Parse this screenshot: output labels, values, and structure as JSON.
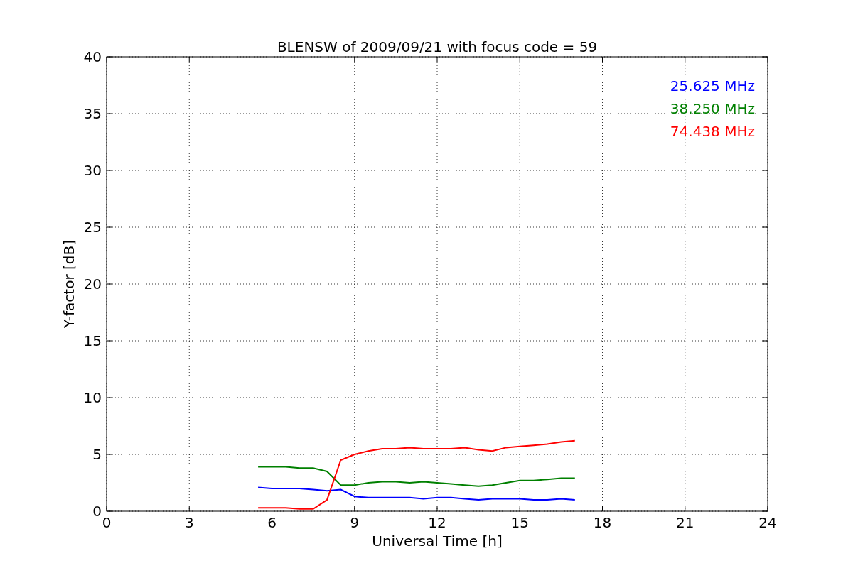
{
  "chart_data": {
    "type": "line",
    "title": "BLENSW of 2009/09/21 with focus code = 59",
    "xlabel": "Universal Time [h]",
    "ylabel": "Y-factor [dB]",
    "x": [
      5.5,
      6,
      6.5,
      7,
      7.5,
      8,
      8.5,
      9,
      9.5,
      10,
      10.5,
      11,
      11.5,
      12,
      12.5,
      13,
      13.5,
      14,
      14.5,
      15,
      15.5,
      16,
      16.5,
      17
    ],
    "series": [
      {
        "name": "25.625 MHz",
        "color": "#0000ff",
        "values": [
          2.1,
          2.0,
          2.0,
          2.0,
          1.9,
          1.8,
          1.9,
          1.3,
          1.2,
          1.2,
          1.2,
          1.2,
          1.1,
          1.2,
          1.2,
          1.1,
          1.0,
          1.1,
          1.1,
          1.1,
          1.0,
          1.0,
          1.1,
          1.0
        ]
      },
      {
        "name": "38.250 MHz",
        "color": "#008000",
        "values": [
          3.9,
          3.9,
          3.9,
          3.8,
          3.8,
          3.5,
          2.3,
          2.3,
          2.5,
          2.6,
          2.6,
          2.5,
          2.6,
          2.5,
          2.4,
          2.3,
          2.2,
          2.3,
          2.5,
          2.7,
          2.7,
          2.8,
          2.9,
          2.9
        ]
      },
      {
        "name": "74.438 MHz",
        "color": "#ff0000",
        "values": [
          0.3,
          0.3,
          0.3,
          0.2,
          0.2,
          1.0,
          4.5,
          5.0,
          5.3,
          5.5,
          5.5,
          5.6,
          5.5,
          5.5,
          5.5,
          5.6,
          5.4,
          5.3,
          5.6,
          5.7,
          5.8,
          5.9,
          6.1,
          6.2
        ]
      }
    ],
    "xlim": [
      0,
      24
    ],
    "ylim": [
      0,
      40
    ],
    "xticks": [
      0,
      3,
      6,
      9,
      12,
      15,
      18,
      21,
      24
    ],
    "yticks": [
      0,
      5,
      10,
      15,
      20,
      25,
      30,
      35,
      40
    ],
    "grid": true
  }
}
